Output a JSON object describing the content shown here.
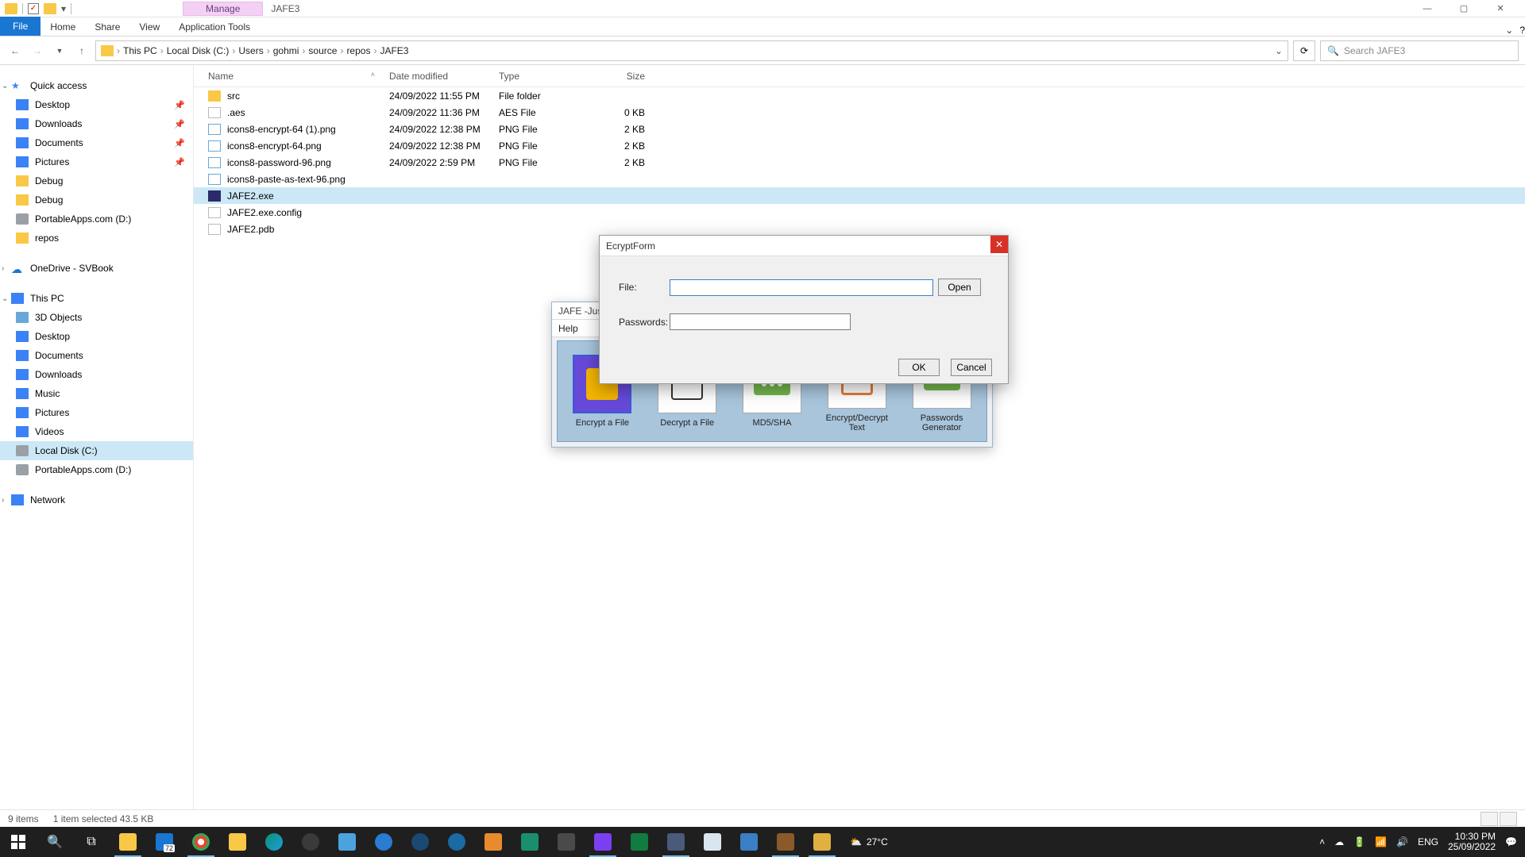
{
  "window": {
    "manage_tab": "Manage",
    "title": "JAFE3",
    "help": "?"
  },
  "ribbon": {
    "file": "File",
    "home": "Home",
    "share": "Share",
    "view": "View",
    "app_tools": "Application Tools"
  },
  "addressbar": {
    "crumbs": [
      "This PC",
      "Local Disk (C:)",
      "Users",
      "gohmi",
      "source",
      "repos",
      "JAFE3"
    ],
    "search_placeholder": "Search JAFE3"
  },
  "sidebar": {
    "quick": "Quick access",
    "quick_items": [
      {
        "label": "Desktop",
        "pinned": true
      },
      {
        "label": "Downloads",
        "pinned": true
      },
      {
        "label": "Documents",
        "pinned": true
      },
      {
        "label": "Pictures",
        "pinned": true
      },
      {
        "label": "Debug",
        "pinned": false
      },
      {
        "label": "Debug",
        "pinned": false
      },
      {
        "label": "PortableApps.com (D:)",
        "pinned": false
      },
      {
        "label": "repos",
        "pinned": false
      }
    ],
    "onedrive": "OneDrive - SVBook",
    "thispc": "This PC",
    "thispc_items": [
      "3D Objects",
      "Desktop",
      "Documents",
      "Downloads",
      "Music",
      "Pictures",
      "Videos",
      "Local Disk (C:)",
      "PortableApps.com (D:)"
    ],
    "network": "Network"
  },
  "columns": {
    "name": "Name",
    "date": "Date modified",
    "type": "Type",
    "size": "Size"
  },
  "files": [
    {
      "name": "src",
      "date": "24/09/2022 11:55 PM",
      "type": "File folder",
      "size": "",
      "icon": "folder"
    },
    {
      "name": ".aes",
      "date": "24/09/2022 11:36 PM",
      "type": "AES File",
      "size": "0 KB",
      "icon": "file"
    },
    {
      "name": "icons8-encrypt-64 (1).png",
      "date": "24/09/2022 12:38 PM",
      "type": "PNG File",
      "size": "2 KB",
      "icon": "img"
    },
    {
      "name": "icons8-encrypt-64.png",
      "date": "24/09/2022 12:38 PM",
      "type": "PNG File",
      "size": "2 KB",
      "icon": "img"
    },
    {
      "name": "icons8-password-96.png",
      "date": "24/09/2022 2:59 PM",
      "type": "PNG File",
      "size": "2 KB",
      "icon": "img"
    },
    {
      "name": "icons8-paste-as-text-96.png",
      "date": "",
      "type": "",
      "size": "",
      "icon": "img"
    },
    {
      "name": "JAFE2.exe",
      "date": "",
      "type": "",
      "size": "",
      "icon": "exe",
      "selected": true
    },
    {
      "name": "JAFE2.exe.config",
      "date": "",
      "type": "",
      "size": "",
      "icon": "file"
    },
    {
      "name": "JAFE2.pdb",
      "date": "",
      "type": "",
      "size": "",
      "icon": "file"
    }
  ],
  "jafe": {
    "title": "JAFE -Just",
    "menu_help": "Help",
    "tiles": [
      {
        "label": "Encrypt a File"
      },
      {
        "label": "Decrypt a File"
      },
      {
        "label": "MD5/SHA"
      },
      {
        "label": "Encrypt/Decrypt Text"
      },
      {
        "label": "Passwords Generator"
      }
    ]
  },
  "dialog": {
    "title": "EcryptForm",
    "file_label": "File:",
    "pw_label": "Passwords:",
    "open": "Open",
    "ok": "OK",
    "cancel": "Cancel",
    "file_value": "",
    "pw_value": ""
  },
  "status": {
    "items": "9 items",
    "selection": "1 item selected  43.5 KB"
  },
  "tray": {
    "temp": "27°C",
    "lang": "ENG",
    "time": "10:30 PM",
    "date": "25/09/2022"
  },
  "taskbar_badge": "72"
}
